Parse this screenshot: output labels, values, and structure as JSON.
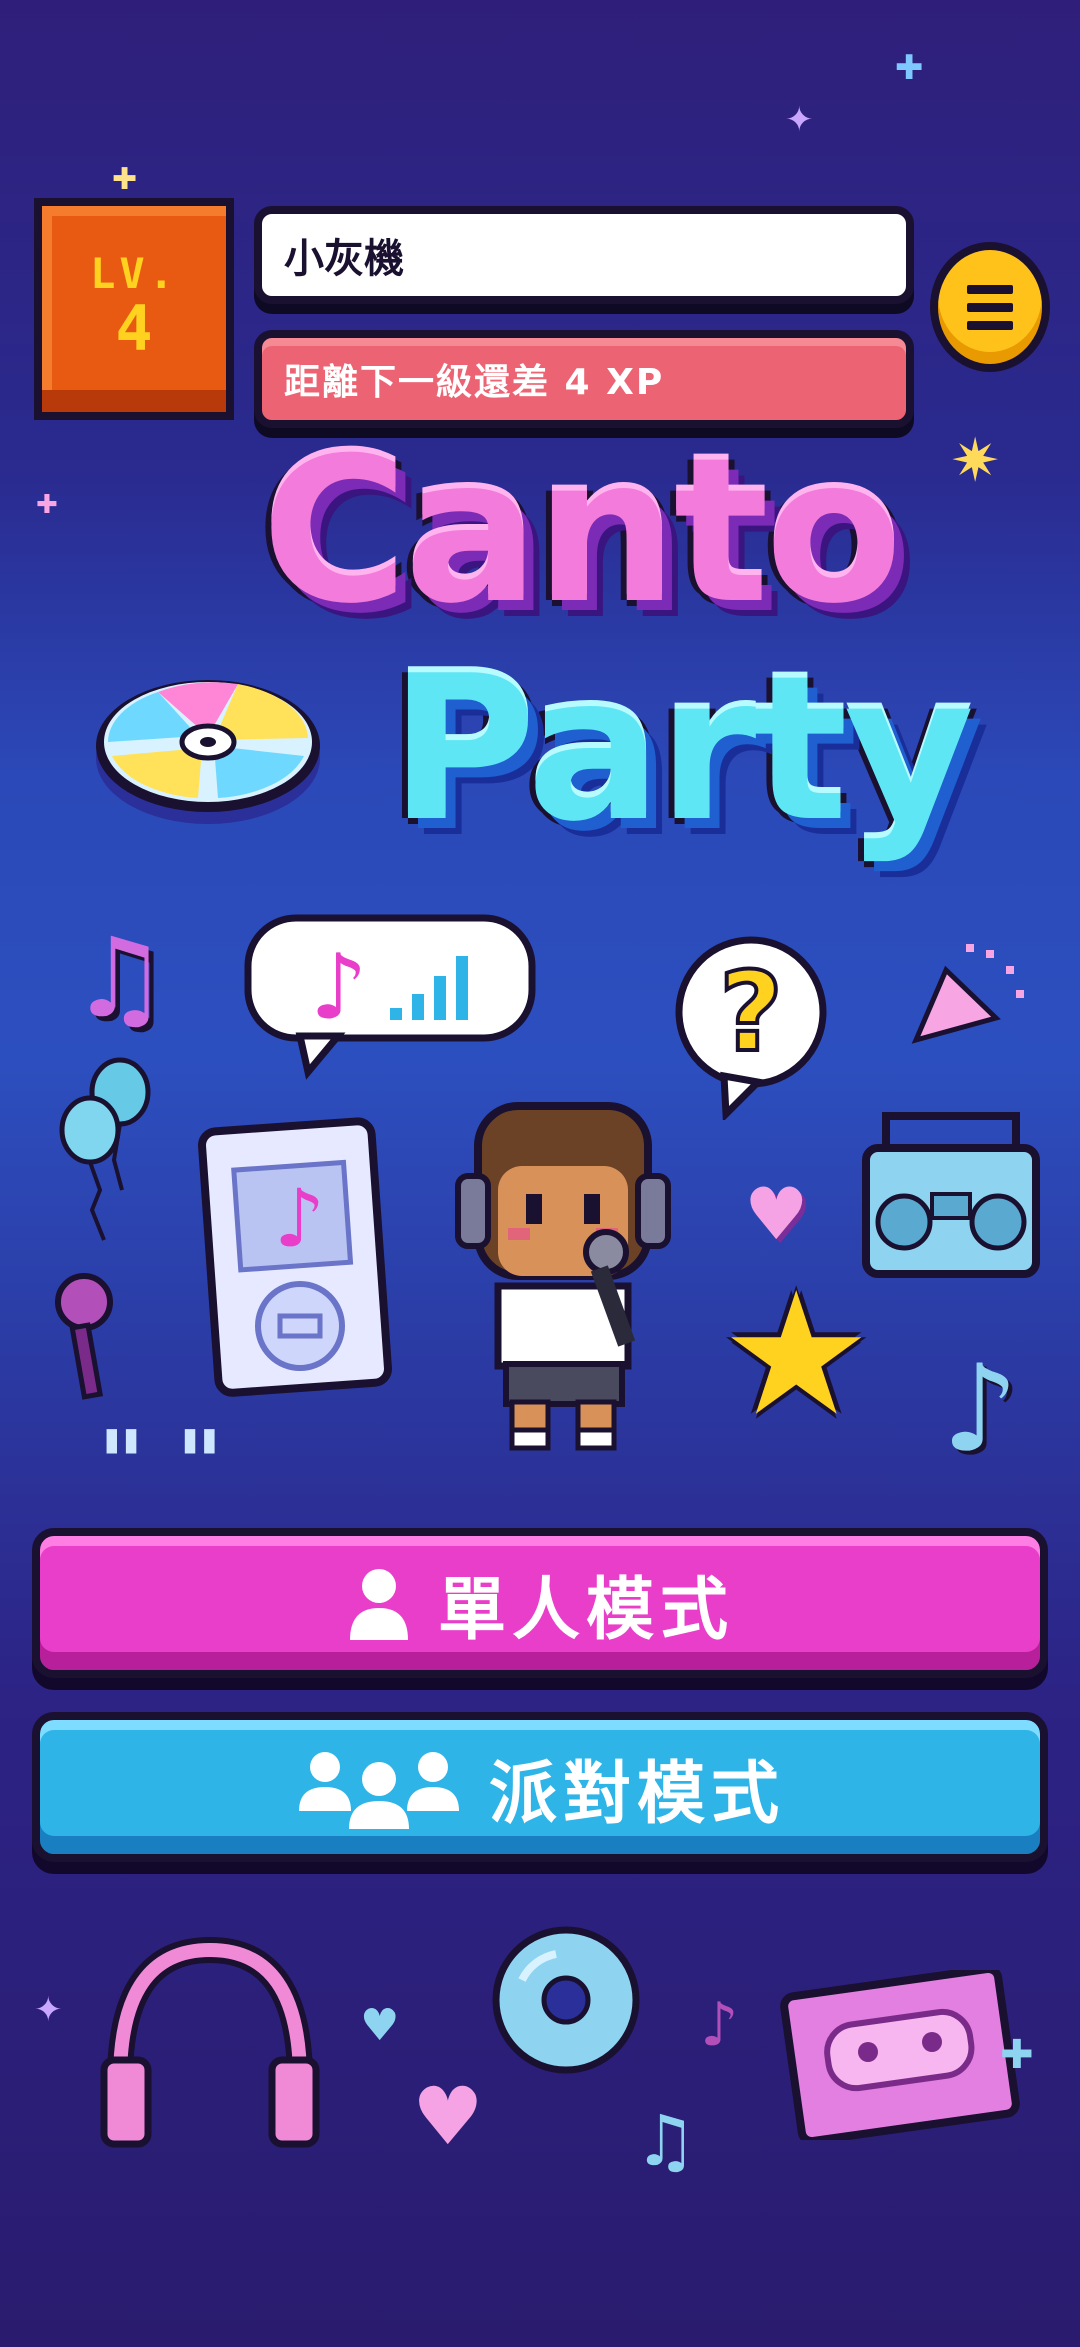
{
  "header": {
    "level_label": "LV.",
    "level_value": "4",
    "player_name": "小灰機",
    "xp_text": "距離下一級還差 4 XP"
  },
  "title": {
    "line1": "Canto",
    "line2": "Party"
  },
  "modes": {
    "solo_label": "單人模式",
    "party_label": "派對模式"
  },
  "icons": {
    "menu": "hamburger-menu-icon",
    "solo": "single-person-icon",
    "party": "group-people-icon"
  },
  "colors": {
    "background": "#2b3aa3",
    "level_box": "#e85a12",
    "xp_bar": "#ec6473",
    "menu_button": "#ffc21a",
    "solo_button": "#e93ec9",
    "party_button": "#2fb4e8"
  }
}
